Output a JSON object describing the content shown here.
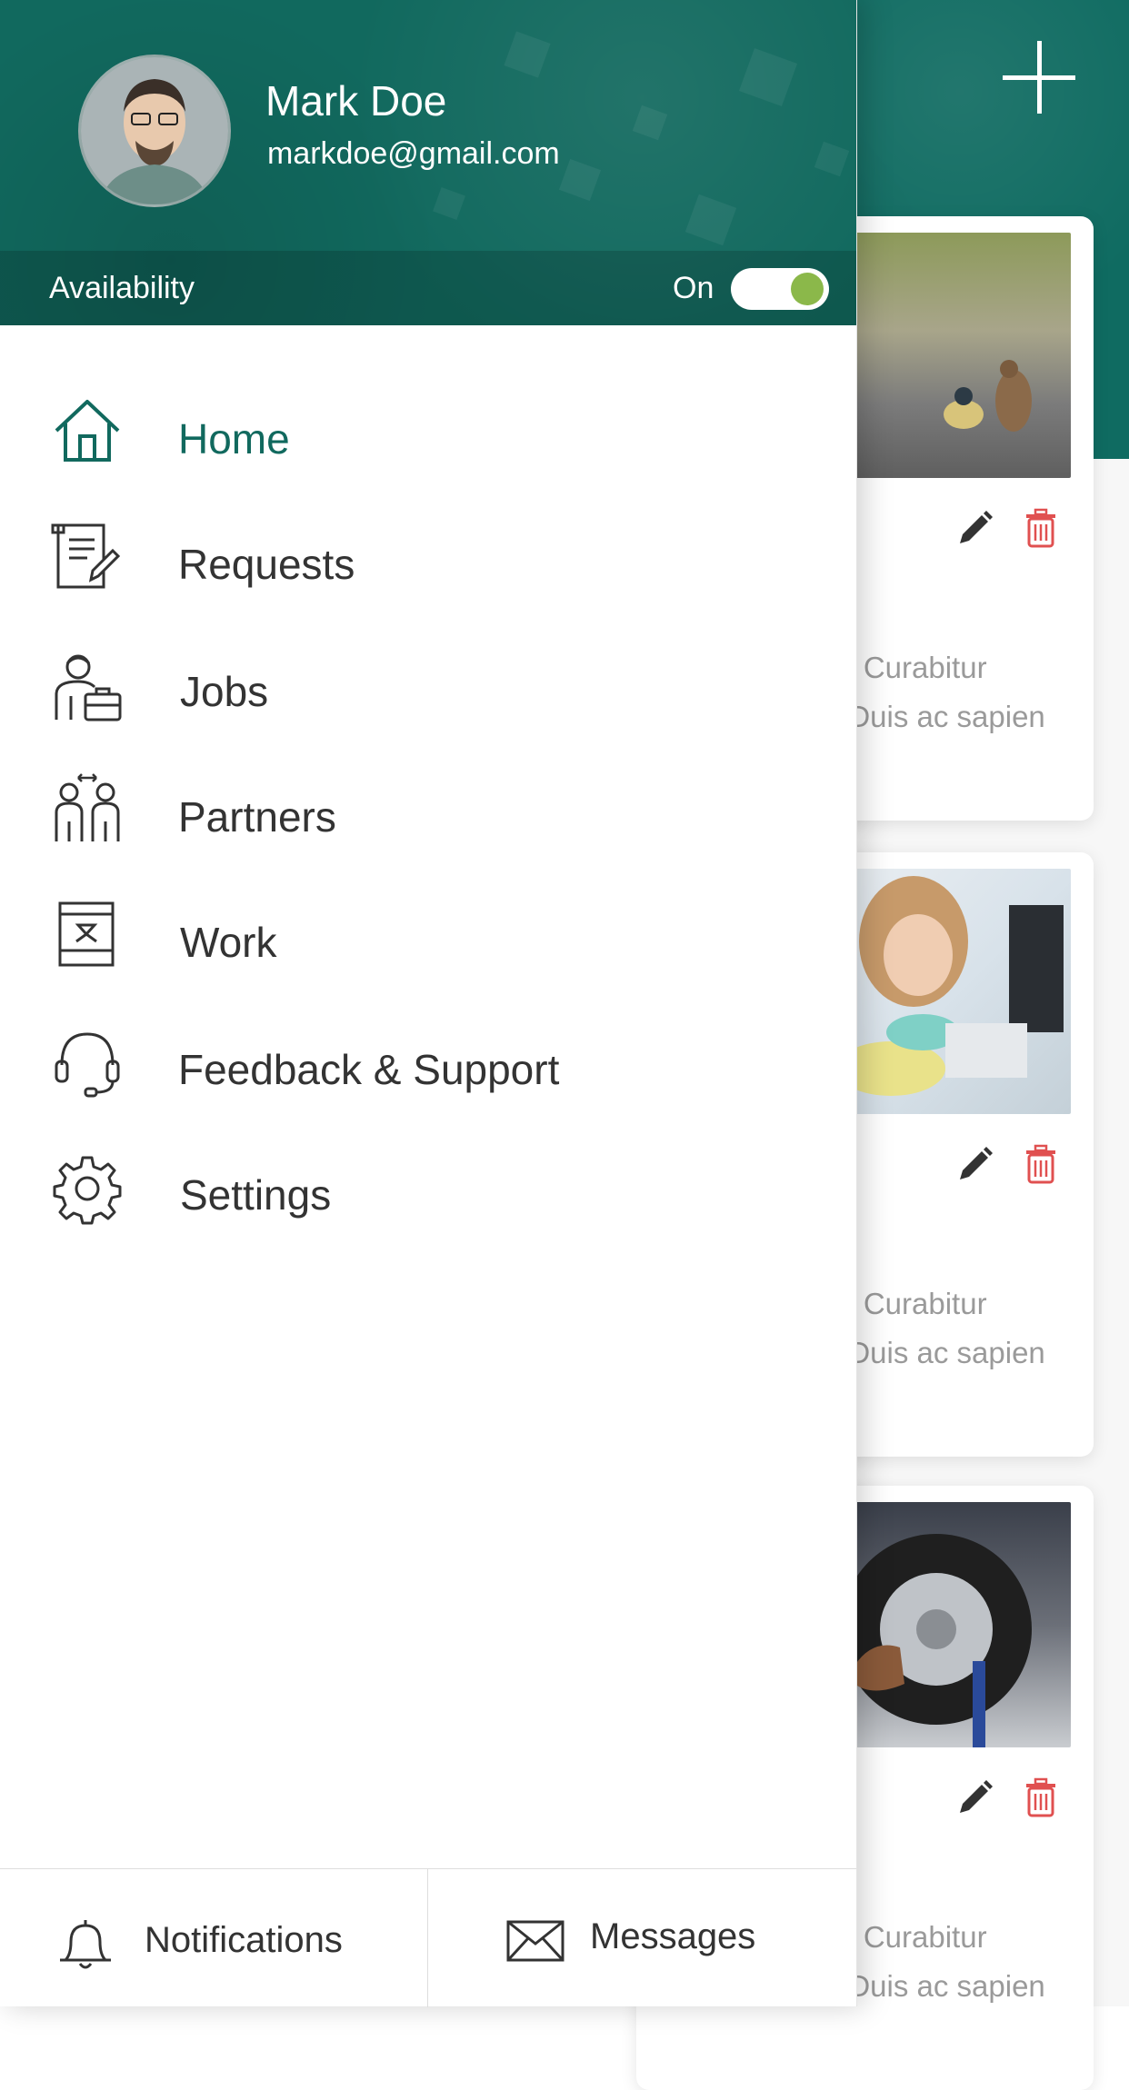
{
  "background": {
    "add_icon": "plus-icon",
    "cards": [
      {
        "text_line1": "it. Curabitur",
        "text_line2": ". Duis ac sapien",
        "image": "birds-photo"
      },
      {
        "text_line1": "it. Curabitur",
        "text_line2": ". Duis ac sapien",
        "image": "cleaning-photo"
      },
      {
        "text_line1": "it. Curabitur",
        "text_line2": ". Duis ac sapien",
        "image": "tire-photo"
      }
    ],
    "delete_color": "#e05050"
  },
  "drawer": {
    "user": {
      "name": "Mark Doe",
      "email": "markdoe@gmail.com"
    },
    "availability": {
      "label": "Availability",
      "state": "On",
      "toggle_on": true,
      "knob_color": "#8bb84a"
    },
    "menu": [
      {
        "label": "Home",
        "icon": "home-icon",
        "active": true
      },
      {
        "label": "Requests",
        "icon": "document-edit-icon"
      },
      {
        "label": "Jobs",
        "icon": "worker-briefcase-icon"
      },
      {
        "label": "Partners",
        "icon": "partners-icon"
      },
      {
        "label": "Work",
        "icon": "work-board-icon"
      },
      {
        "label": "Feedback & Support",
        "icon": "headset-icon"
      },
      {
        "label": "Settings",
        "icon": "gear-icon"
      }
    ],
    "footer": {
      "notifications": {
        "label": "Notifications",
        "icon": "bell-icon"
      },
      "messages": {
        "label": "Messages",
        "icon": "envelope-icon"
      }
    }
  },
  "colors": {
    "accent": "#11695e",
    "text": "#333333"
  }
}
